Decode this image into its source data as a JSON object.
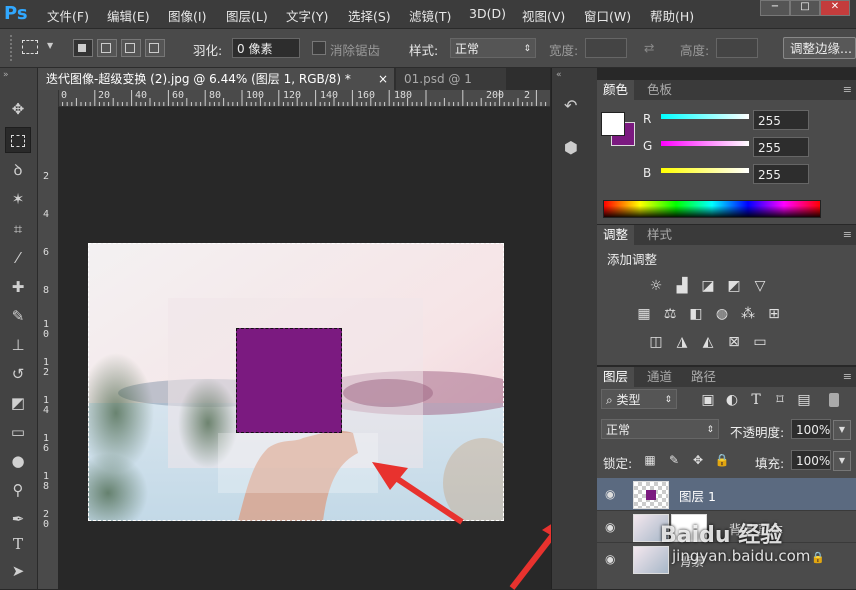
{
  "app": {
    "logo": "Ps"
  },
  "menu": [
    "文件(F)",
    "编辑(E)",
    "图像(I)",
    "图层(L)",
    "文字(Y)",
    "选择(S)",
    "滤镜(T)",
    "3D(D)",
    "视图(V)",
    "窗口(W)",
    "帮助(H)"
  ],
  "window_controls": {
    "minimize": "−",
    "restore": "□",
    "close": "✕"
  },
  "options": {
    "feather_label": "羽化:",
    "feather_value": "0 像素",
    "antialias_label": "消除锯齿",
    "style_label": "样式:",
    "style_value": "正常",
    "width_label": "宽度:",
    "height_label": "高度:",
    "refine_button": "调整边缘..."
  },
  "tabs": [
    {
      "label": "迭代图像-超级变换 (2).jpg @ 6.44% (图层 1, RGB/8) *",
      "close": "×"
    },
    {
      "label": "01.psd @ 1",
      "close": ""
    }
  ],
  "ruler": {
    "top": [
      "0",
      "20",
      "40",
      "60",
      "80",
      "100",
      "120",
      "140",
      "160",
      "180",
      "200",
      "2"
    ],
    "left": [
      "2",
      "4",
      "6",
      "8",
      "1\n0",
      "1\n2",
      "1\n4",
      "1\n6",
      "1\n8",
      "2\n0"
    ]
  },
  "color_panel": {
    "tabs": [
      "颜色",
      "色板"
    ],
    "channels": [
      {
        "label": "R",
        "value": "255",
        "gradient": "#00ffff"
      },
      {
        "label": "G",
        "value": "255",
        "gradient": "#ff00ff"
      },
      {
        "label": "B",
        "value": "255",
        "gradient": "#ffff00"
      }
    ],
    "foreground": "#ffffff",
    "background": "#7b1a80"
  },
  "adjust_panel": {
    "tabs": [
      "调整",
      "样式"
    ],
    "title": "添加调整"
  },
  "layers_panel": {
    "tabs": [
      "图层",
      "通道",
      "路径"
    ],
    "filter_kind": "类型",
    "blend_mode": "正常",
    "opacity_label": "不透明度:",
    "opacity_value": "100%",
    "lock_label": "锁定:",
    "fill_label": "填充:",
    "fill_value": "100%",
    "layers": [
      {
        "name": "图层 1"
      },
      {
        "name": "背景 副本"
      },
      {
        "name": "背景"
      }
    ]
  },
  "watermark": {
    "text": "Baidu 经验",
    "subtext": "jingyan.baidu.com"
  },
  "colors": {
    "selection_fill": "#7b1a80",
    "arrow": "#e8322e",
    "accent": "#31a8ff"
  }
}
